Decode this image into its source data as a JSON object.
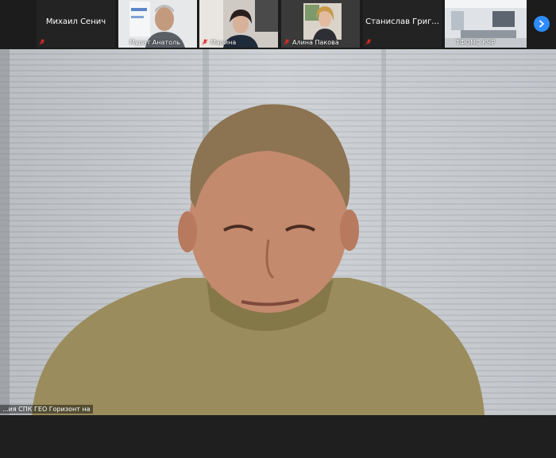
{
  "thumbnails": [
    {
      "name": "Михаил Сенич",
      "video": false
    },
    {
      "name": "Мурат Анатоль",
      "video": true
    },
    {
      "name": "Марина",
      "video": true
    },
    {
      "name": "Алина Пакова",
      "video": true
    },
    {
      "name": "Станислав Григ...",
      "video": false
    },
    {
      "name": "ТФОМС КЧР",
      "video": true
    }
  ],
  "main": {
    "name": "...ия СПК ГЕО Горизонт на"
  },
  "colors": {
    "accent": "#2d8cff",
    "mute": "#e02828"
  },
  "icons": {
    "next": "chevron-right-icon",
    "mute": "microphone-muted-icon"
  }
}
